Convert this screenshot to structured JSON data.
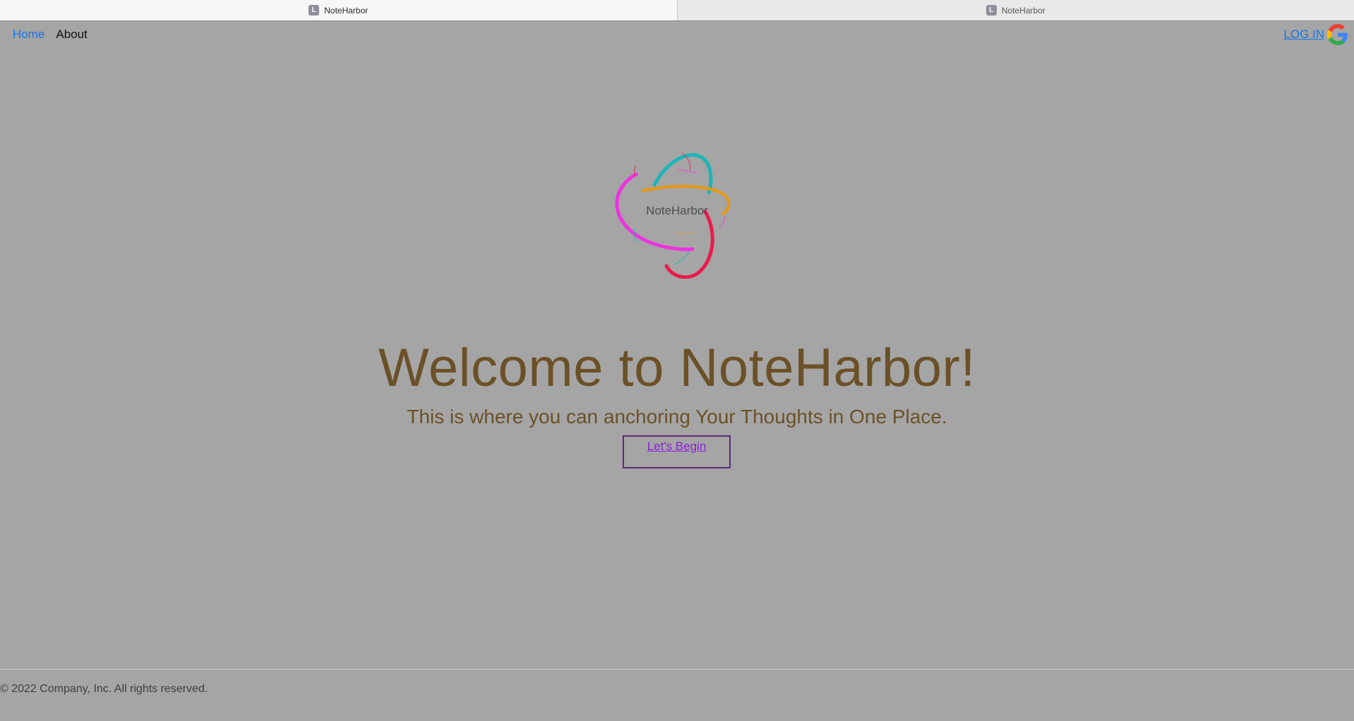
{
  "browser": {
    "tabs": [
      {
        "favicon": "L",
        "title": "NoteHarbor",
        "active": true
      },
      {
        "favicon": "L",
        "title": "NoteHarbor",
        "active": false
      }
    ]
  },
  "nav": {
    "home_label": "Home",
    "about_label": "About",
    "login_label": "LOG IN",
    "login_icon": "google-icon"
  },
  "logo": {
    "text": "NoteHarbor",
    "colors": {
      "teal": "#1db5b6",
      "orange": "#e8970e",
      "magenta": "#ec34e0",
      "red": "#e91a4c"
    }
  },
  "hero": {
    "title": "Welcome to NoteHarbor!",
    "subtitle": "This is where you can anchoring Your Thoughts in One Place.",
    "cta_label": "Let's Begin"
  },
  "footer": {
    "copyright": "© 2022 Company, Inc. All rights reserved."
  },
  "colors": {
    "background": "#a5a5a5",
    "link": "#1a73e8",
    "hero_text": "#6b5128",
    "cta_border": "#5d2a78",
    "cta_text": "#8a1fd6"
  }
}
